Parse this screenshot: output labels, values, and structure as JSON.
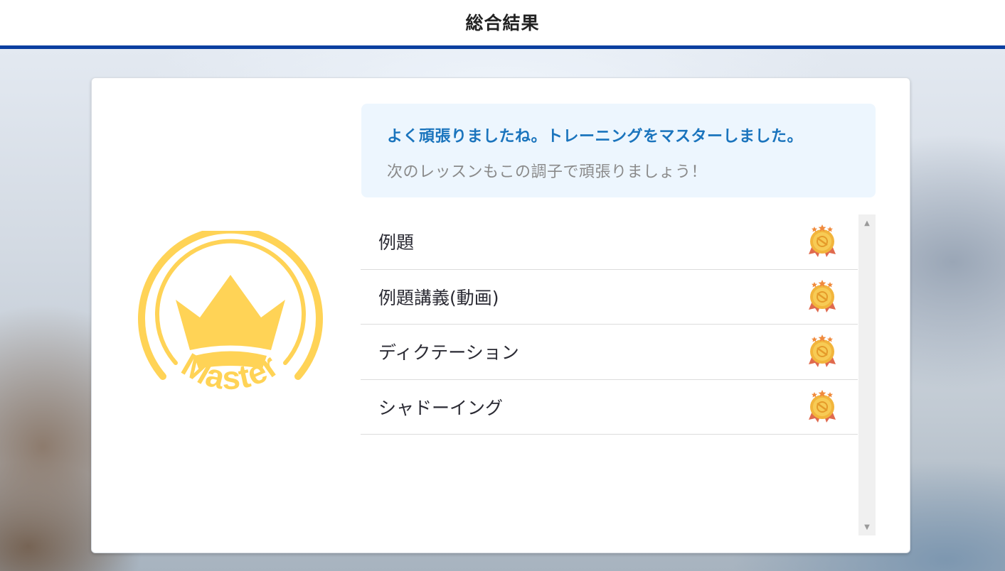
{
  "header": {
    "title": "総合結果"
  },
  "message": {
    "main": "よく頑張りましたね。トレーニングをマスターしました。",
    "sub": "次のレッスンもこの調子で頑張りましょう！"
  },
  "badge": {
    "text": "Master",
    "color": "#ffd356"
  },
  "lessons": [
    {
      "label": "例題",
      "status_icon": "gold-medal-icon"
    },
    {
      "label": "例題講義(動画)",
      "status_icon": "gold-medal-icon"
    },
    {
      "label": "ディクテーション",
      "status_icon": "gold-medal-icon"
    },
    {
      "label": "シャドーイング",
      "status_icon": "gold-medal-icon"
    }
  ],
  "colors": {
    "header_border": "#0a3fa0",
    "message_main": "#1a74bd",
    "message_bg": "#edf6fe"
  }
}
